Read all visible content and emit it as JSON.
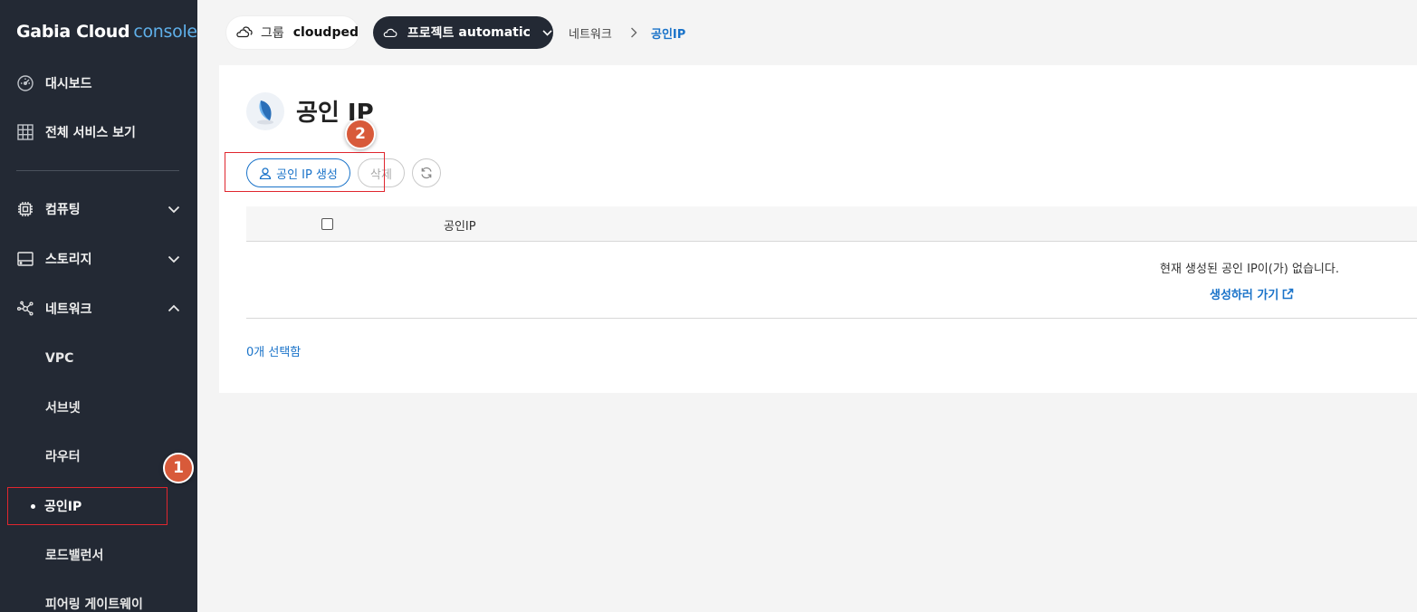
{
  "sidebar": {
    "brand": "Gabia Cloud",
    "brand_accent": "console",
    "top_items": [
      {
        "label": "대시보드",
        "icon": "dashboard-icon"
      },
      {
        "label": "전체 서비스 보기",
        "icon": "grid-icon"
      }
    ],
    "sections": [
      {
        "label": "컴퓨팅",
        "icon": "cpu-icon",
        "expanded": false
      },
      {
        "label": "스토리지",
        "icon": "storage-icon",
        "expanded": false
      },
      {
        "label": "네트워크",
        "icon": "network-icon",
        "expanded": true
      }
    ],
    "network_items": [
      "VPC",
      "서브넷",
      "라우터",
      "공인IP",
      "로드밸런서",
      "피어링 게이트웨이"
    ],
    "active_item": "공인IP"
  },
  "topbar": {
    "group_label": "그룹",
    "group_value": "cloudped",
    "project_label": "프로젝트",
    "project_value": "automatic",
    "breadcrumb": [
      "네트워크",
      "공인IP"
    ]
  },
  "page": {
    "title": "공인 IP",
    "buttons": {
      "create": "공인 IP 생성",
      "delete": "삭제"
    },
    "table": {
      "column_header": "공인IP",
      "empty_message": "현재 생성된 공인 IP이(가) 없습니다.",
      "create_link": "생성하러 가기"
    },
    "selected_count": "0개 선택함"
  },
  "annotations": {
    "step1": "1",
    "step2": "2"
  },
  "colors": {
    "sidebar_bg": "#232934",
    "accent": "#1a73c9",
    "highlight": "#e0262e",
    "badge": "#d85a3a"
  }
}
